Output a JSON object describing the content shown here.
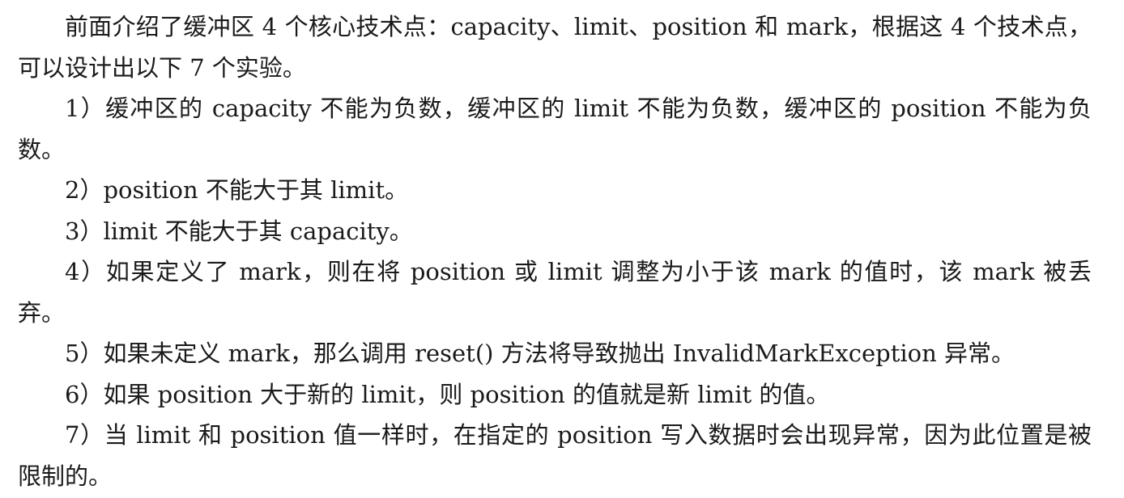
{
  "paragraphs": [
    "前面介绍了缓冲区 4 个核心技术点：capacity、limit、position 和 mark，根据这 4 个技术点，可以设计出以下 7 个实验。",
    "1）缓冲区的 capacity 不能为负数，缓冲区的 limit 不能为负数，缓冲区的 position 不能为负数。",
    "2）position 不能大于其 limit。",
    "3）limit 不能大于其 capacity。",
    "4）如果定义了 mark，则在将 position 或 limit 调整为小于该 mark 的值时，该 mark 被丢弃。",
    "5）如果未定义 mark，那么调用 reset() 方法将导致抛出 InvalidMarkException 异常。",
    "6）如果 position 大于新的 limit，则 position 的值就是新 limit 的值。",
    "7）当 limit 和 position 值一样时，在指定的 position 写入数据时会出现异常，因为此位置是被限制的。"
  ]
}
